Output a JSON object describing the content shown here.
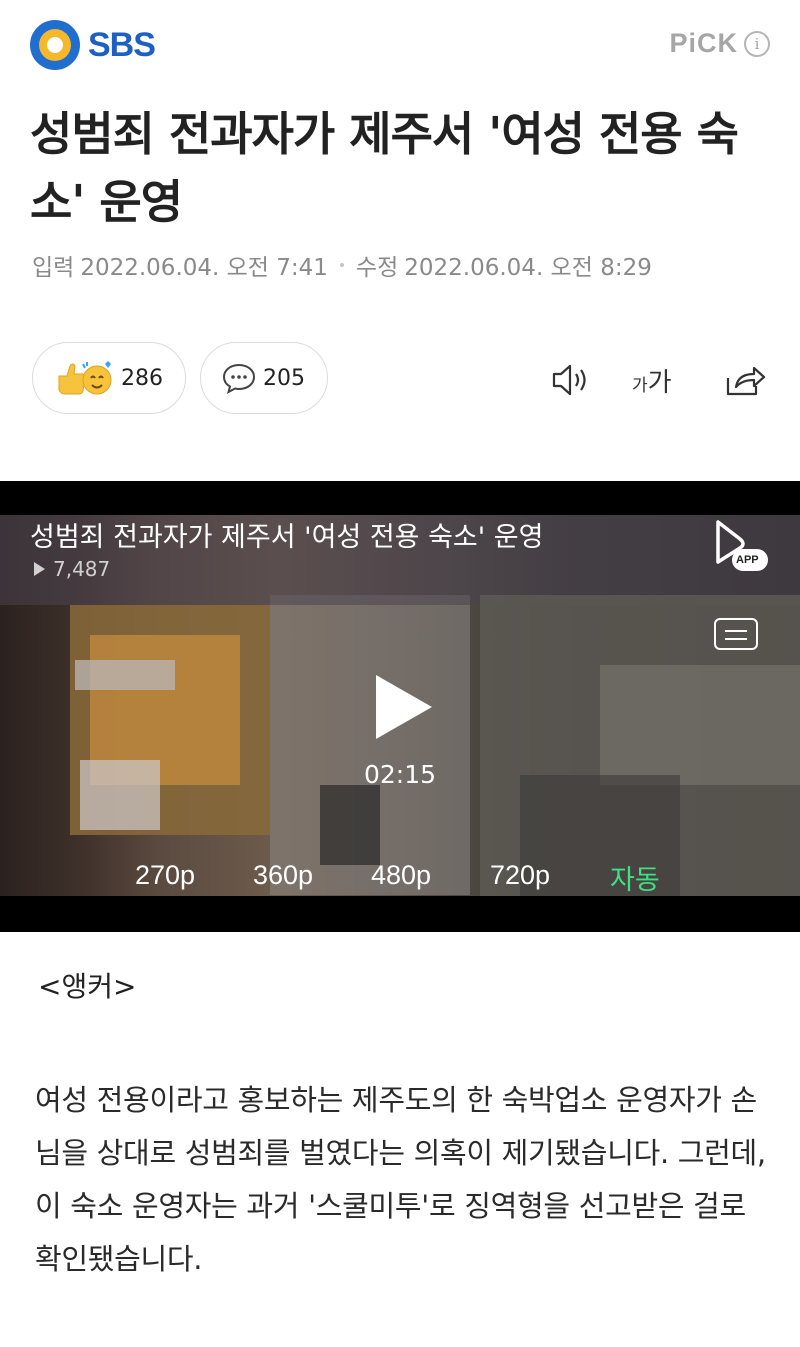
{
  "header": {
    "brand": "SBS",
    "pick_label": "PiCK",
    "pick_info": "i"
  },
  "article": {
    "title": "성범죄 전과자가 제주서 '여성 전용 숙소' 운영",
    "input_label": "입력",
    "input_datetime": "2022.06.04. 오전 7:41",
    "edit_label": "수정",
    "edit_datetime": "2022.06.04. 오전 8:29"
  },
  "actions": {
    "reactions_count": "286",
    "comments_count": "205",
    "font_size_label_small": "가",
    "font_size_label_large": "가"
  },
  "video": {
    "title": "성범죄 전과자가 제주서 '여성 전용 숙소' 운영",
    "views": "7,487",
    "app_badge": "APP",
    "duration": "02:15",
    "qualities": [
      "270p",
      "360p",
      "480p",
      "720p",
      "자동"
    ],
    "active_quality": "자동",
    "active_color": "#3ee081"
  },
  "body": {
    "anchor": "<앵커>",
    "paragraph": "여성 전용이라고 홍보하는 제주도의 한 숙박업소 운영자가 손님을 상대로 성범죄를 벌였다는 의혹이 제기됐습니다. 그런데, 이 숙소 운영자는 과거 '스쿨미투'로 징역형을 선고받은 걸로 확인됐습니다."
  }
}
